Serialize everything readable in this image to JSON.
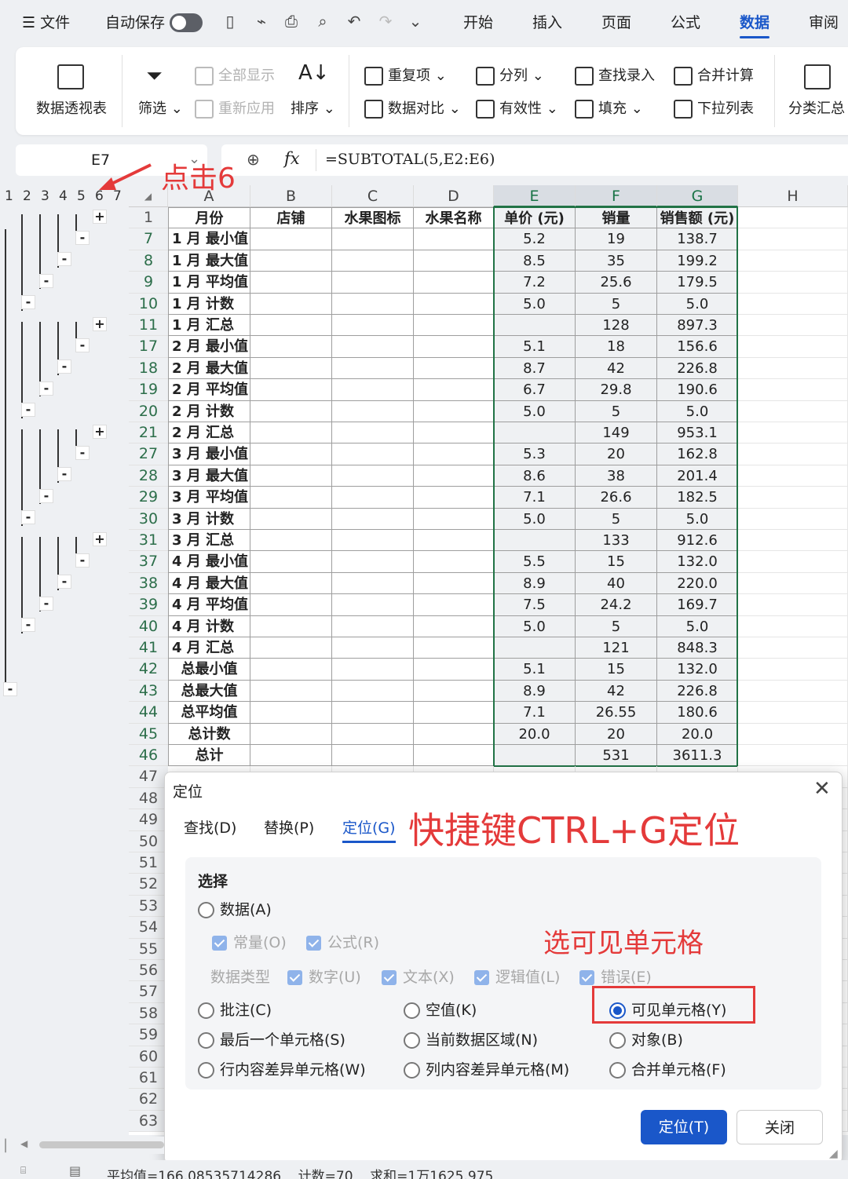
{
  "menubar": {
    "menu_label": "文件",
    "autosave_label": "自动保存",
    "tabs": [
      "开始",
      "插入",
      "页面",
      "公式",
      "数据",
      "审阅"
    ],
    "active_tab": "数据"
  },
  "ribbon": {
    "pivot": "数据透视表",
    "filter": "筛选",
    "show_all": "全部显示",
    "reapply": "重新应用",
    "sort": "排序",
    "duplicates": "重复项",
    "compare": "数据对比",
    "split": "分列",
    "validity": "有效性",
    "lookup": "查找录入",
    "fill": "填充",
    "consolidate": "合并计算",
    "dropdown": "下拉列表",
    "subtotal": "分类汇总"
  },
  "formula_bar": {
    "name_box": "E7",
    "fx": "fx",
    "formula": "=SUBTOTAL(5,E2:E6)"
  },
  "outline_levels": [
    "1",
    "2",
    "3",
    "4",
    "5",
    "6",
    "7"
  ],
  "columns": [
    "A",
    "B",
    "C",
    "D",
    "E",
    "F",
    "G",
    "H"
  ],
  "headers": [
    "月份",
    "店铺",
    "水果图标",
    "水果名称",
    "单价 (元)",
    "销量",
    "销售额 (元)"
  ],
  "rows": [
    {
      "r": "7",
      "a": "1 月 最小值",
      "e": "5.2",
      "f": "19",
      "g": "138.7"
    },
    {
      "r": "8",
      "a": "1 月 最大值",
      "e": "8.5",
      "f": "35",
      "g": "199.2"
    },
    {
      "r": "9",
      "a": "1 月 平均值",
      "e": "7.2",
      "f": "25.6",
      "g": "179.5"
    },
    {
      "r": "10",
      "a": "1 月 计数",
      "e": "5.0",
      "f": "5",
      "g": "5.0"
    },
    {
      "r": "11",
      "a": "1 月 汇总",
      "e": "",
      "f": "128",
      "g": "897.3"
    },
    {
      "r": "17",
      "a": "2 月 最小值",
      "e": "5.1",
      "f": "18",
      "g": "156.6"
    },
    {
      "r": "18",
      "a": "2 月 最大值",
      "e": "8.7",
      "f": "42",
      "g": "226.8"
    },
    {
      "r": "19",
      "a": "2 月 平均值",
      "e": "6.7",
      "f": "29.8",
      "g": "190.6"
    },
    {
      "r": "20",
      "a": "2 月 计数",
      "e": "5.0",
      "f": "5",
      "g": "5.0"
    },
    {
      "r": "21",
      "a": "2 月 汇总",
      "e": "",
      "f": "149",
      "g": "953.1"
    },
    {
      "r": "27",
      "a": "3 月 最小值",
      "e": "5.3",
      "f": "20",
      "g": "162.8"
    },
    {
      "r": "28",
      "a": "3 月 最大值",
      "e": "8.6",
      "f": "38",
      "g": "201.4"
    },
    {
      "r": "29",
      "a": "3 月 平均值",
      "e": "7.1",
      "f": "26.6",
      "g": "182.5"
    },
    {
      "r": "30",
      "a": "3 月 计数",
      "e": "5.0",
      "f": "5",
      "g": "5.0"
    },
    {
      "r": "31",
      "a": "3 月 汇总",
      "e": "",
      "f": "133",
      "g": "912.6"
    },
    {
      "r": "37",
      "a": "4 月 最小值",
      "e": "5.5",
      "f": "15",
      "g": "132.0"
    },
    {
      "r": "38",
      "a": "4 月 最大值",
      "e": "8.9",
      "f": "40",
      "g": "220.0"
    },
    {
      "r": "39",
      "a": "4 月 平均值",
      "e": "7.5",
      "f": "24.2",
      "g": "169.7"
    },
    {
      "r": "40",
      "a": "4 月 计数",
      "e": "5.0",
      "f": "5",
      "g": "5.0"
    },
    {
      "r": "41",
      "a": "4 月 汇总",
      "e": "",
      "f": "121",
      "g": "848.3"
    },
    {
      "r": "42",
      "a": "总最小值",
      "e": "5.1",
      "f": "15",
      "g": "132.0"
    },
    {
      "r": "43",
      "a": "总最大值",
      "e": "8.9",
      "f": "42",
      "g": "226.8"
    },
    {
      "r": "44",
      "a": "总平均值",
      "e": "7.1",
      "f": "26.55",
      "g": "180.6"
    },
    {
      "r": "45",
      "a": "总计数",
      "e": "20.0",
      "f": "20",
      "g": "20.0"
    },
    {
      "r": "46",
      "a": "总计",
      "e": "",
      "f": "531",
      "g": "3611.3"
    }
  ],
  "extra_rows": [
    "47",
    "48",
    "49",
    "50",
    "51",
    "52",
    "53",
    "54",
    "55",
    "56",
    "57",
    "58",
    "59",
    "60",
    "61",
    "62",
    "63"
  ],
  "outline_buttons": {
    "plus": "+",
    "minus": "-"
  },
  "dialog": {
    "title": "定位",
    "tabs": [
      "查找(D)",
      "替换(P)",
      "定位(G)"
    ],
    "group_label": "选择",
    "data": "数据(A)",
    "constants": "常量(O)",
    "formulas": "公式(R)",
    "data_type_label": "数据类型",
    "numbers": "数字(U)",
    "text": "文本(X)",
    "logicals": "逻辑值(L)",
    "errors": "错误(E)",
    "comments": "批注(C)",
    "blanks": "空值(K)",
    "visible_cells": "可见单元格(Y)",
    "last_cell": "最后一个单元格(S)",
    "current_region": "当前数据区域(N)",
    "objects": "对象(B)",
    "row_diff": "行内容差异单元格(W)",
    "col_diff": "列内容差异单元格(M)",
    "merged": "合并单元格(F)",
    "ok": "定位(T)",
    "close": "关闭"
  },
  "annotations": {
    "click6": "点击6",
    "shortcut": "快捷键CTRL+G定位",
    "choose_visible": "选可见单元格"
  },
  "statusbar": {
    "text": "平均值=166.08535714286    计数=70    求和=1万1625.975"
  },
  "colors": {
    "accent": "#1a57c9",
    "annotation": "#e43a3a",
    "selection_border": "#217346"
  }
}
